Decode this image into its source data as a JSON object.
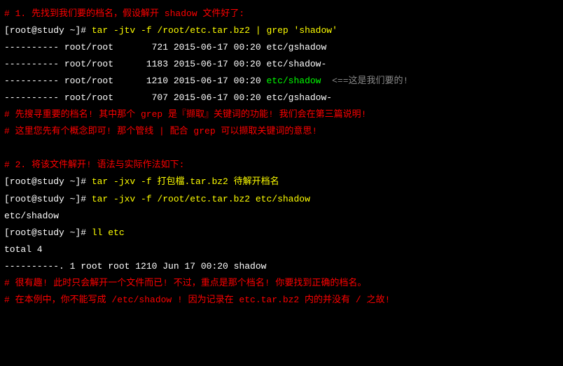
{
  "section1": {
    "comment": "# 1. 先找到我们要的档名，假设解开 shadow 文件好了:",
    "prompt": "[root@study ~]# ",
    "cmd": "tar -jtv -f /root/etc.tar.bz2 | grep 'shadow'",
    "out1": "---------- root/root       721 2015-06-17 00:20 etc/gshadow",
    "out2": "---------- root/root      1183 2015-06-17 00:20 etc/shadow-",
    "out3_pre": "---------- root/root      1210 2015-06-17 00:20 ",
    "out3_target": "etc/shadow",
    "out3_note": "  <==这是我们要的!",
    "out4": "---------- root/root       707 2015-06-17 00:20 etc/gshadow-",
    "note1": "# 先搜寻重要的档名! 其中那个 grep 是『撷取』关键词的功能! 我们会在第三篇说明!",
    "note2": "# 这里您先有个概念即可! 那个管线 | 配合 grep 可以撷取关键词的意思!"
  },
  "section2": {
    "comment": "# 2. 将该文件解开! 语法与实际作法如下:",
    "prompt": "[root@study ~]# ",
    "cmd_template": "tar -jxv -f 打包檔.tar.bz2 待解开档名",
    "cmd_real": "tar -jxv -f /root/etc.tar.bz2 etc/shadow",
    "out1": "etc/shadow",
    "cmd_ls": "ll etc",
    "out2": "total 4",
    "out3": "----------. 1 root root 1210 Jun 17 00:20 shadow",
    "note1": "# 很有趣! 此时只会解开一个文件而已! 不过，重点是那个档名! 你要找到正确的档名。",
    "note2": "# 在本例中，你不能写成 /etc/shadow ! 因为记录在 etc.tar.bz2 内的并没有 / 之故!"
  }
}
